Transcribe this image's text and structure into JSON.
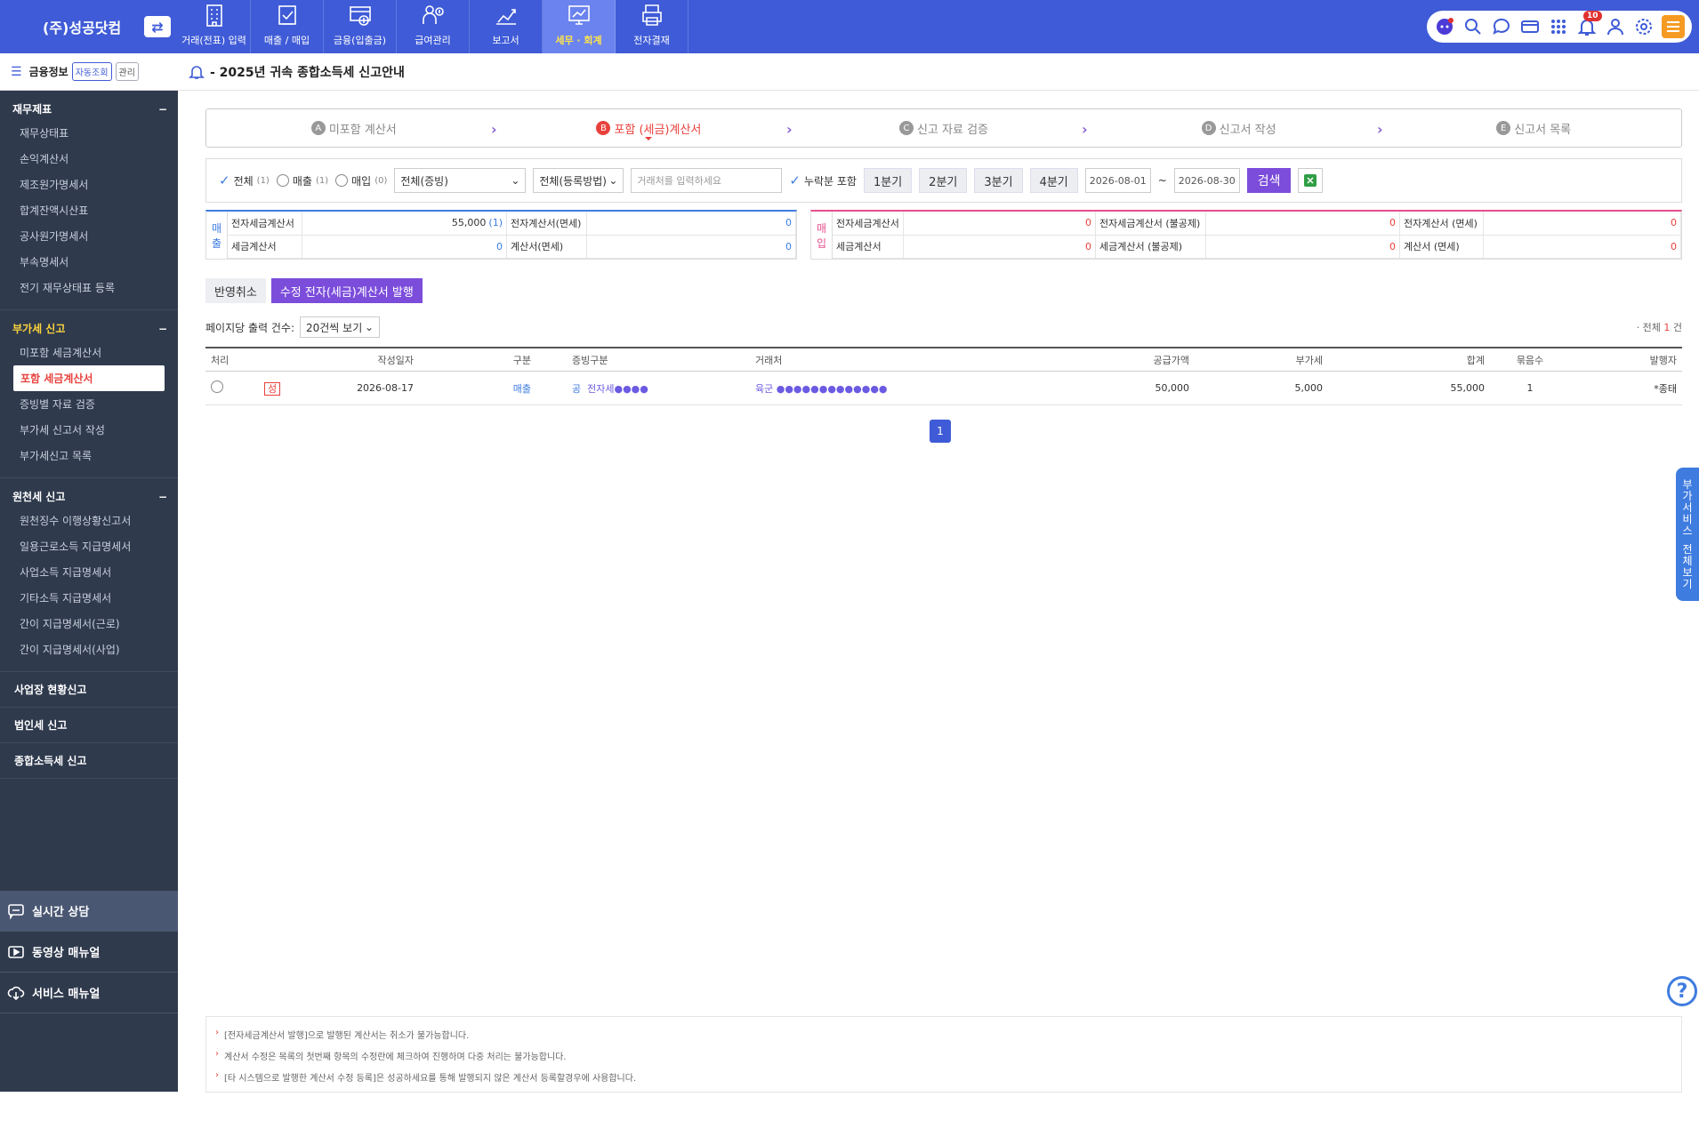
{
  "brand": {
    "name": "(주)성공닷컴"
  },
  "topmenu": [
    {
      "label": "거래(전표) 입력",
      "icon": "building-icon"
    },
    {
      "label": "매출 / 매입",
      "icon": "clipboard-icon"
    },
    {
      "label": "금융(입출금)",
      "icon": "money-card-icon"
    },
    {
      "label": "급여관리",
      "icon": "payroll-icon"
    },
    {
      "label": "보고서",
      "icon": "chart-growth-icon"
    },
    {
      "label": "세무 · 회계",
      "icon": "tax-report-icon",
      "active": true
    },
    {
      "label": "전자결재",
      "icon": "approval-printer-icon"
    }
  ],
  "util": {
    "badge": "10"
  },
  "sidebar": {
    "fin_label": "금융정보",
    "auto_btn": "자동조회",
    "manage_btn": "관리",
    "sections": [
      {
        "title": "재무제표",
        "items": [
          "재무상태표",
          "손익계산서",
          "제조원가명세서",
          "합계잔액시산표",
          "공사원가명세서",
          "부속명세서",
          "전기 재무상태표 등록"
        ]
      },
      {
        "title": "부가세 신고",
        "items": [
          "미포함 세금계산서",
          "포함 세금계산서",
          "증빙별 자료 검증",
          "부가세 신고서 작성",
          "부가세신고 목록"
        ],
        "active_index": 1
      },
      {
        "title": "원천세 신고",
        "items": [
          "원천징수 이행상황신고서",
          "일용근로소득 지급명세서",
          "사업소득 지급명세서",
          "기타소득 지급명세서",
          "간이 지급명세서(근로)",
          "간이 지급명세서(사업)"
        ]
      }
    ],
    "plain": [
      "사업장 현황신고",
      "법인세 신고",
      "종합소득세 신고"
    ],
    "help": [
      "실시간 상담",
      "동영상 매뉴얼",
      "서비스 매뉴얼"
    ]
  },
  "page": {
    "title": "- 2025년 귀속 종합소득세 신고안내"
  },
  "steps": [
    {
      "letter": "A",
      "label": "미포함 계산서"
    },
    {
      "letter": "B",
      "label": "포함 (세금)계산서",
      "active": true
    },
    {
      "letter": "C",
      "label": "신고 자료 검증"
    },
    {
      "letter": "D",
      "label": "신고서 작성"
    },
    {
      "letter": "E",
      "label": "신고서 목록"
    }
  ],
  "filter": {
    "all": "전체",
    "all_cnt": "(1)",
    "sales": "매출",
    "sales_cnt": "(1)",
    "purchase": "매입",
    "purchase_cnt": "(0)",
    "proof_select": "전체(증빙)",
    "reg_select": "전체(등록방법)",
    "partner_placeholder": "거래처를 입력하세요",
    "omitted": "누락분 포함",
    "quarters": [
      "1분기",
      "2분기",
      "3분기",
      "4분기"
    ],
    "date_from": "2026-08-01",
    "tilde": "~",
    "date_to": "2026-08-30",
    "search": "검색"
  },
  "summary_sales": {
    "tag": [
      "매",
      "출"
    ],
    "r1": {
      "l1": "전자세금계산서",
      "v1": "55,000",
      "c1": "(1)",
      "l2": "전자계산서(면세)",
      "v2": "0"
    },
    "r2": {
      "l1": "세금계산서",
      "v1": "0",
      "l2": "계산서(면세)",
      "v2": "0"
    }
  },
  "summary_purchase": {
    "tag": [
      "매",
      "입"
    ],
    "r1": {
      "l1": "전자세금계산서",
      "v1": "0",
      "l2": "전자세금계산서 (불공제)",
      "v2": "0",
      "l3": "전자계산서 (면세)",
      "v3": "0"
    },
    "r2": {
      "l1": "세금계산서",
      "v1": "0",
      "l2": "세금계산서 (불공제)",
      "v2": "0",
      "l3": "계산서 (면세)",
      "v3": "0"
    }
  },
  "actions": {
    "cancel": "반영취소",
    "issue": "수정 전자(세금)계산서 발행"
  },
  "list": {
    "perpage_label": "페이지당 출력 건수:",
    "perpage": "20건씩 보기",
    "total_prefix": "· 전체",
    "total_num": "1",
    "total_suffix": "건"
  },
  "table": {
    "headers": [
      "처리",
      "",
      "작성일자",
      "구분",
      "증빙구분",
      "거래처",
      "공급가액",
      "부가세",
      "합계",
      "묶음수",
      "발행자"
    ],
    "rows": [
      {
        "tag": "성",
        "date": "2026-08-17",
        "type": "매출",
        "proof_tag": "공",
        "proof": "전자세●●●●",
        "partner": "육군 ●●●●●●●●●●●●●",
        "supply": "50,000",
        "vat": "5,000",
        "total": "55,000",
        "bundle": "1",
        "issuer": "*종태"
      }
    ]
  },
  "pager": [
    "1"
  ],
  "right_tab": [
    "부",
    "가",
    "서",
    "비",
    "스",
    "전",
    "체",
    "보",
    "기"
  ],
  "notes": [
    "[전자세금계산서 발행]으로 발행된 계산서는 취소가 불가능합니다.",
    "계산서 수정은 목록의 첫번째 항목의 수정란에 체크하여 진행하며 다중 처리는 불가능합니다.",
    "[타 시스템으로 발행한 계산서 수정 등록]은 성공하세요를 통해 발행되지 않은 계산서 등록할경우에 사용합니다."
  ],
  "colors": {
    "primary": "#3f5bd7",
    "accent_purple": "#7c4ddb",
    "red": "#e8413c",
    "sidebar": "#2f3a4d"
  }
}
